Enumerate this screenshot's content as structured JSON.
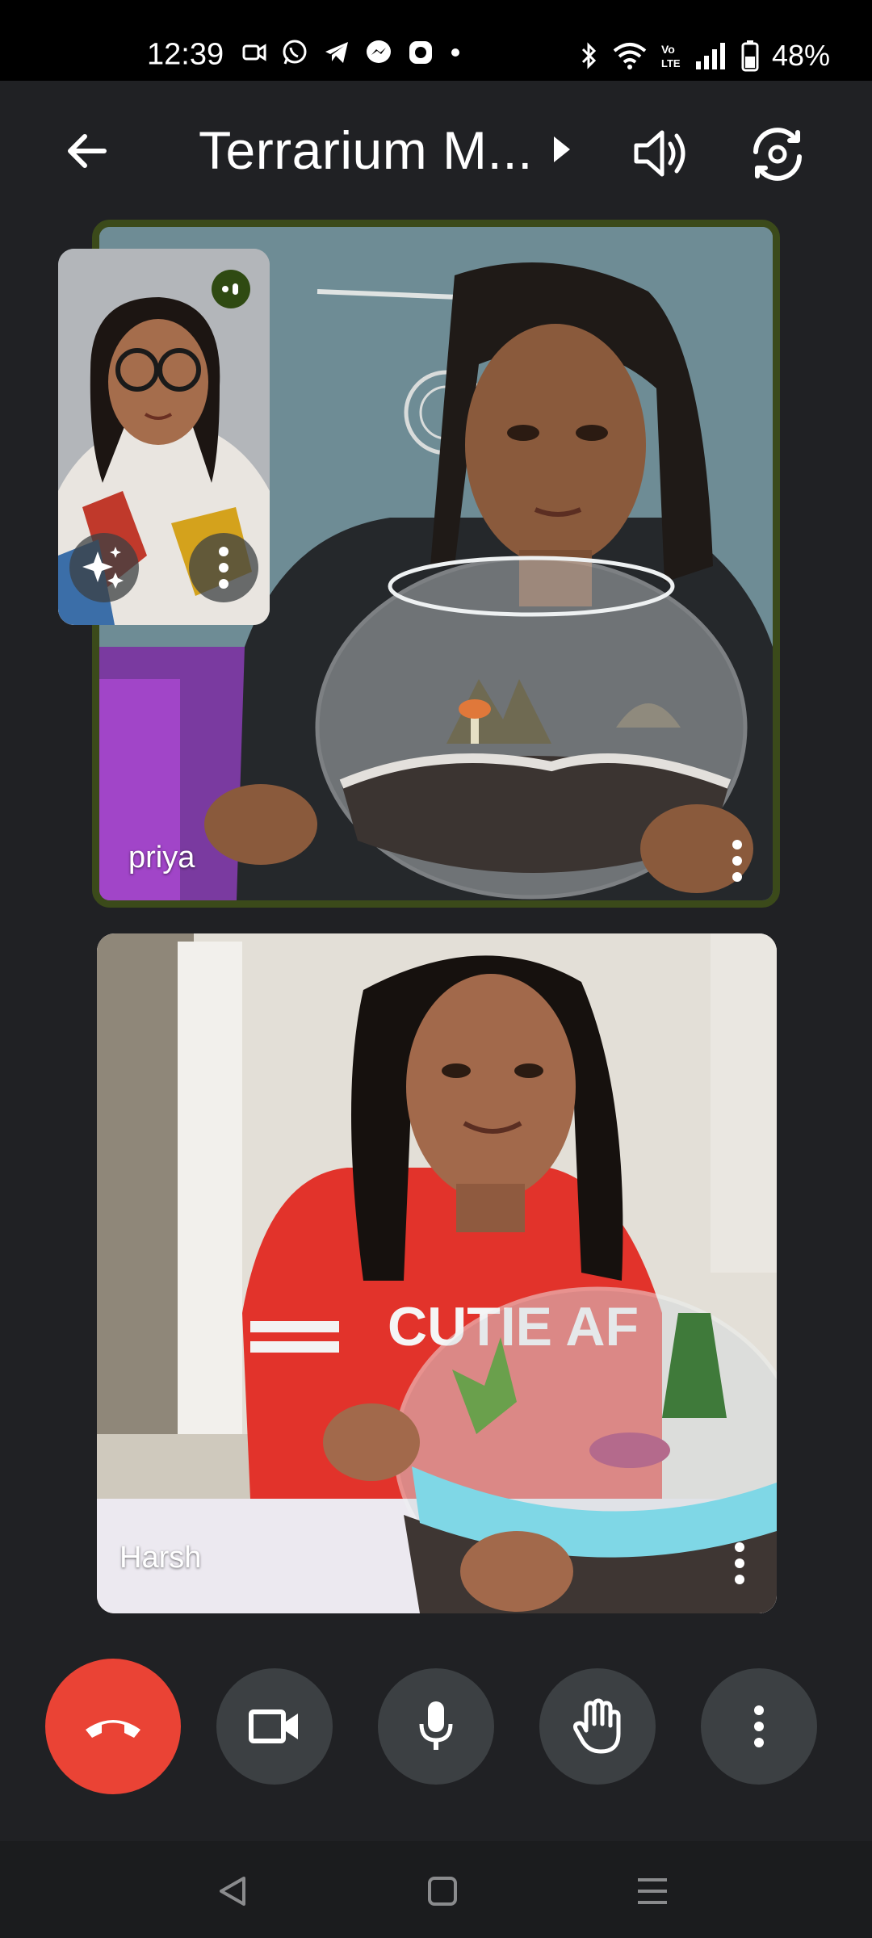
{
  "status_bar": {
    "time": "12:39",
    "battery": "48%",
    "notification_icons": [
      "video-icon",
      "whatsapp-icon",
      "telegram-icon",
      "messenger-icon",
      "camera-app-icon",
      "dot-icon"
    ],
    "system_icons": [
      "bluetooth-icon",
      "wifi-icon",
      "volte-icon",
      "signal-icon",
      "battery-icon"
    ]
  },
  "header": {
    "title": "Terrarium M...",
    "colors": {
      "icon": "#ffffff"
    }
  },
  "participants": [
    {
      "name": "priya",
      "active_speaker": true
    },
    {
      "name": "Harsh",
      "active_speaker": false
    }
  ],
  "self_view": {
    "speaking_indicator": true
  },
  "controls": {
    "end_call_color": "#ea4335",
    "button_bg": "#3c4043",
    "buttons": [
      "end-call-icon",
      "camera-icon",
      "microphone-icon",
      "raise-hand-icon",
      "more-options-icon"
    ]
  },
  "colors": {
    "background": "#202124",
    "active_border": "#3b4a1a"
  }
}
